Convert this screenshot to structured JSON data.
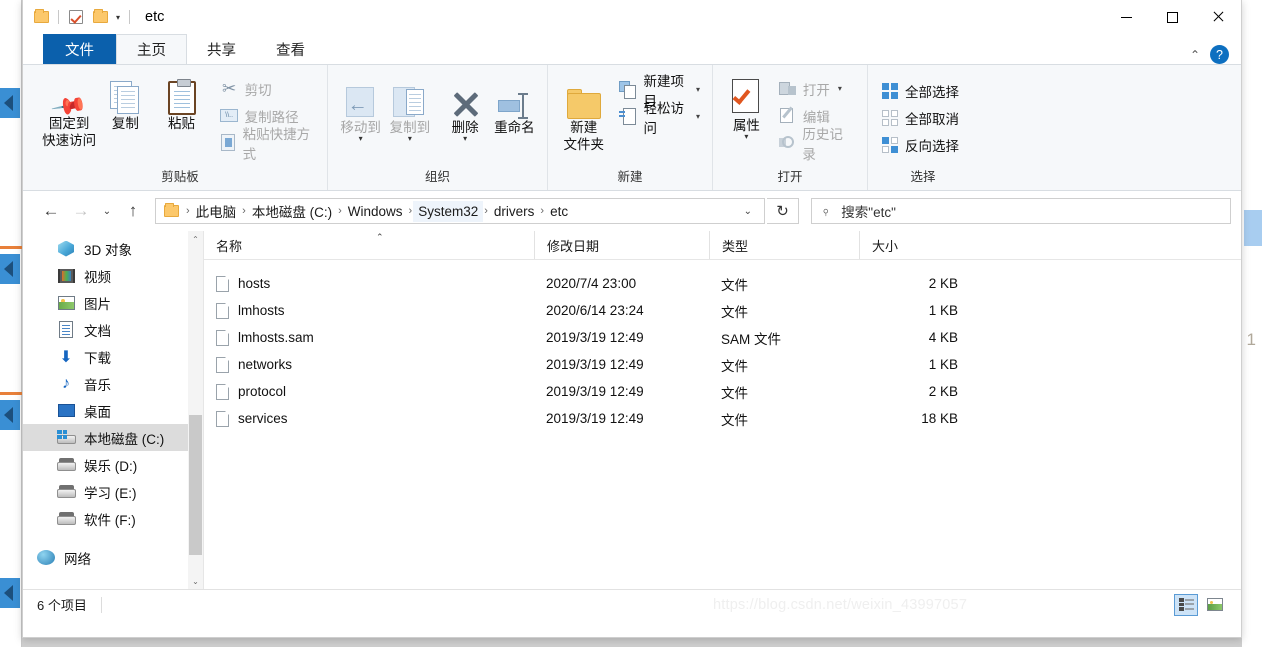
{
  "window": {
    "title": "etc",
    "quick_access_icons": [
      "folder-icon",
      "checkbox-properties-icon",
      "folder-icon"
    ],
    "controls": {
      "minimize": "minimize-icon",
      "maximize": "maximize-icon",
      "close": "close-icon"
    }
  },
  "tabs": [
    {
      "id": "file",
      "label": "文件"
    },
    {
      "id": "home",
      "label": "主页"
    },
    {
      "id": "share",
      "label": "共享"
    },
    {
      "id": "view",
      "label": "查看"
    }
  ],
  "ribbon": {
    "collapse_icon": "chevron-up-icon",
    "help_label": "?",
    "groups": [
      {
        "name": "clipboard",
        "label": "剪贴板",
        "big_buttons": [
          {
            "name": "pin-to-quick-access",
            "line1": "固定到",
            "line2": "快速访问",
            "icon": "pin-icon"
          },
          {
            "name": "copy",
            "line1": "复制",
            "line2": "",
            "icon": "copy-icon"
          },
          {
            "name": "paste",
            "line1": "粘贴",
            "line2": "",
            "icon": "clipboard-icon"
          }
        ],
        "small_buttons": [
          {
            "name": "cut",
            "label": "剪切",
            "icon": "scissors-icon",
            "disabled": true
          },
          {
            "name": "copy-path",
            "label": "复制路径",
            "icon": "path-icon",
            "disabled": true
          },
          {
            "name": "paste-shortcut",
            "label": "粘贴快捷方式",
            "icon": "paste-shortcut-icon",
            "disabled": true
          }
        ]
      },
      {
        "name": "organize",
        "label": "组织",
        "big_buttons": [
          {
            "name": "move-to",
            "line1": "移动到",
            "line2": "",
            "icon": "move-to-icon",
            "disabled": true,
            "caret": true
          },
          {
            "name": "copy-to",
            "line1": "复制到",
            "line2": "",
            "icon": "copy-to-icon",
            "disabled": true,
            "caret": true
          },
          {
            "name": "delete",
            "line1": "删除",
            "line2": "",
            "icon": "delete-x-icon",
            "caret": true
          },
          {
            "name": "rename",
            "line1": "重命名",
            "line2": "",
            "icon": "rename-icon"
          }
        ]
      },
      {
        "name": "new",
        "label": "新建",
        "big_buttons": [
          {
            "name": "new-folder",
            "line1": "新建",
            "line2": "文件夹",
            "icon": "folder-icon"
          }
        ],
        "small_buttons": [
          {
            "name": "new-item",
            "label": "新建项目",
            "icon": "new-item-icon",
            "caret": true
          },
          {
            "name": "easy-access",
            "label": "轻松访问",
            "icon": "easy-access-icon",
            "caret": true
          }
        ]
      },
      {
        "name": "open",
        "label": "打开",
        "big_buttons": [
          {
            "name": "properties",
            "line1": "属性",
            "line2": "",
            "icon": "properties-icon",
            "caret": true
          }
        ],
        "small_buttons": [
          {
            "name": "open",
            "label": "打开",
            "icon": "open-icon",
            "disabled": true,
            "caret": true
          },
          {
            "name": "edit",
            "label": "编辑",
            "icon": "edit-icon",
            "disabled": true
          },
          {
            "name": "history",
            "label": "历史记录",
            "icon": "history-icon",
            "disabled": true
          }
        ]
      },
      {
        "name": "select",
        "label": "选择",
        "small_buttons": [
          {
            "name": "select-all",
            "label": "全部选择",
            "icon": "select-all-icon"
          },
          {
            "name": "select-none",
            "label": "全部取消",
            "icon": "select-none-icon"
          },
          {
            "name": "invert-selection",
            "label": "反向选择",
            "icon": "invert-selection-icon"
          }
        ]
      }
    ]
  },
  "addressbar": {
    "back_icon": "arrow-left-icon",
    "forward_icon": "arrow-right-icon",
    "recent_icon": "chevron-down-icon",
    "up_icon": "arrow-up-icon",
    "breadcrumbs": [
      "此电脑",
      "本地磁盘 (C:)",
      "Windows",
      "System32",
      "drivers",
      "etc"
    ],
    "dropdown_icon": "chevron-down-icon",
    "refresh_icon": "refresh-icon",
    "search_placeholder": "搜索\"etc\"",
    "search_icon": "search-icon"
  },
  "navpane": {
    "items": [
      {
        "label": "3D 对象",
        "icon": "3d-objects-icon",
        "selected": false
      },
      {
        "label": "视频",
        "icon": "videos-icon",
        "selected": false
      },
      {
        "label": "图片",
        "icon": "pictures-icon",
        "selected": false
      },
      {
        "label": "文档",
        "icon": "documents-icon",
        "selected": false
      },
      {
        "label": "下载",
        "icon": "downloads-icon",
        "selected": false
      },
      {
        "label": "音乐",
        "icon": "music-icon",
        "selected": false
      },
      {
        "label": "桌面",
        "icon": "desktop-icon",
        "selected": false
      },
      {
        "label": "本地磁盘 (C:)",
        "icon": "local-disk-icon",
        "selected": true
      },
      {
        "label": "娱乐 (D:)",
        "icon": "drive-icon",
        "selected": false
      },
      {
        "label": "学习 (E:)",
        "icon": "drive-icon",
        "selected": false
      },
      {
        "label": "软件 (F:)",
        "icon": "drive-icon",
        "selected": false
      },
      {
        "label": "网络",
        "icon": "network-icon",
        "selected": false,
        "root": true
      }
    ],
    "scroll_up_icon": "chevron-up-icon",
    "scroll_down_icon": "chevron-down-icon"
  },
  "filelist": {
    "columns": [
      {
        "key": "name",
        "label": "名称",
        "sorted": true,
        "sort_icon": "caret-up-icon"
      },
      {
        "key": "modified",
        "label": "修改日期"
      },
      {
        "key": "type",
        "label": "类型"
      },
      {
        "key": "size",
        "label": "大小"
      }
    ],
    "rows": [
      {
        "name": "hosts",
        "modified": "2020/7/4 23:00",
        "type": "文件",
        "size": "2 KB",
        "icon": "file-icon"
      },
      {
        "name": "lmhosts",
        "modified": "2020/6/14 23:24",
        "type": "文件",
        "size": "1 KB",
        "icon": "file-icon"
      },
      {
        "name": "lmhosts.sam",
        "modified": "2019/3/19 12:49",
        "type": "SAM 文件",
        "size": "4 KB",
        "icon": "file-icon"
      },
      {
        "name": "networks",
        "modified": "2019/3/19 12:49",
        "type": "文件",
        "size": "1 KB",
        "icon": "file-icon"
      },
      {
        "name": "protocol",
        "modified": "2019/3/19 12:49",
        "type": "文件",
        "size": "2 KB",
        "icon": "file-icon"
      },
      {
        "name": "services",
        "modified": "2019/3/19 12:49",
        "type": "文件",
        "size": "18 KB",
        "icon": "file-icon"
      }
    ]
  },
  "statusbar": {
    "item_count": "6 个项目",
    "watermark": "https://blog.csdn.net/weixin_43997057",
    "view_buttons": [
      {
        "name": "details-view",
        "icon": "details-view-icon",
        "active": true
      },
      {
        "name": "large-icons-view",
        "icon": "thumbnails-view-icon",
        "active": false
      }
    ]
  },
  "colors": {
    "accent": "#0b60ac",
    "selection": "#dcdcdc",
    "ribbon_bg": "#f6f8fa",
    "help_blue": "#0d6fc0"
  }
}
